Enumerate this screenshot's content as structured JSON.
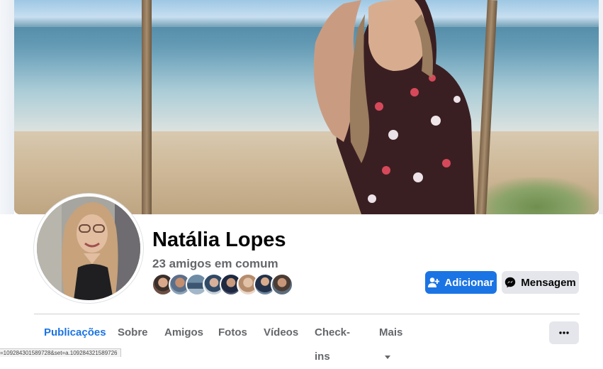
{
  "profile": {
    "name": "Natália Lopes",
    "mutual_friends": "23 amigos em comum"
  },
  "actions": {
    "add_label": "Adicionar",
    "message_label": "Mensagem"
  },
  "tabs": [
    {
      "label": "Publicações",
      "active": true
    },
    {
      "label": "Sobre"
    },
    {
      "label": "Amigos"
    },
    {
      "label": "Fotos"
    },
    {
      "label": "Vídeos"
    },
    {
      "label": "Check-ins"
    },
    {
      "label": "Mais"
    }
  ],
  "status_url": "=109284301589728&set=a.109284321589726",
  "colors": {
    "accent": "#1b74e4",
    "button_gray": "#e4e6eb",
    "text_secondary": "#65676b"
  },
  "icons": {
    "add": "add-friend-icon",
    "message": "messenger-icon",
    "more": "more-dots-icon",
    "caret": "caret-down-icon"
  }
}
